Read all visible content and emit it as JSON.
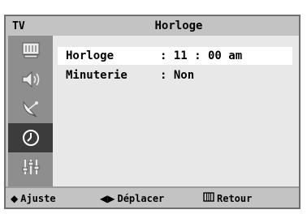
{
  "header": {
    "source_label": "TV",
    "title": "Horloge"
  },
  "sidebar": {
    "items": [
      {
        "icon": "picture-icon",
        "active": false
      },
      {
        "icon": "sound-icon",
        "active": false
      },
      {
        "icon": "channel-icon",
        "active": false
      },
      {
        "icon": "clock-icon",
        "active": true
      },
      {
        "icon": "setup-icon",
        "active": false
      }
    ]
  },
  "menu": {
    "rows": [
      {
        "label": "Horloge",
        "value": ": 11 : 00 am",
        "selected": true
      },
      {
        "label": "Minuterie",
        "value": ": Non",
        "selected": false
      }
    ]
  },
  "footer": {
    "adjust_label": "Ajuste",
    "move_label": "Déplacer",
    "return_label": "Retour"
  },
  "colors": {
    "frame": "#c3c3c3",
    "sidebar": "#8e8e8e",
    "active_item": "#3c3c3c",
    "content": "#e8e8e8",
    "highlight": "#ffffff"
  }
}
